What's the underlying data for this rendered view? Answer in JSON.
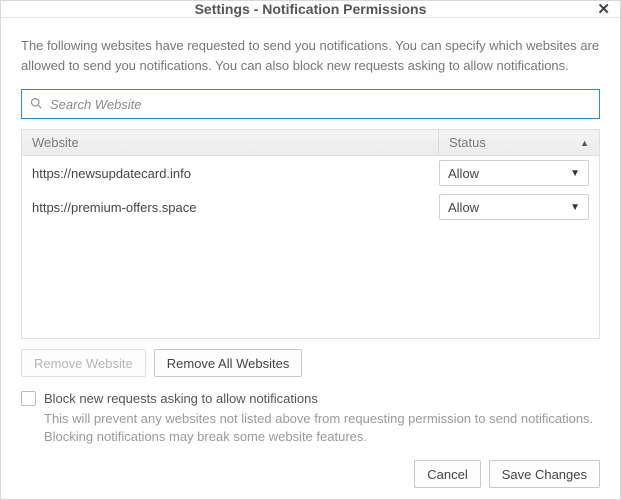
{
  "title": "Settings - Notification Permissions",
  "intro": "The following websites have requested to send you notifications. You can specify which websites are allowed to send you notifications. You can also block new requests asking to allow notifications.",
  "search": {
    "placeholder": "Search Website"
  },
  "table": {
    "headers": {
      "website": "Website",
      "status": "Status"
    },
    "rows": [
      {
        "site": "https://newsupdatecard.info",
        "status": "Allow"
      },
      {
        "site": "https://premium-offers.space",
        "status": "Allow"
      }
    ]
  },
  "buttons": {
    "remove": "Remove Website",
    "removeAll": "Remove All Websites",
    "cancel": "Cancel",
    "save": "Save Changes"
  },
  "block": {
    "label": "Block new requests asking to allow notifications",
    "desc": "This will prevent any websites not listed above from requesting permission to send notifications. Blocking notifications may break some website features."
  }
}
